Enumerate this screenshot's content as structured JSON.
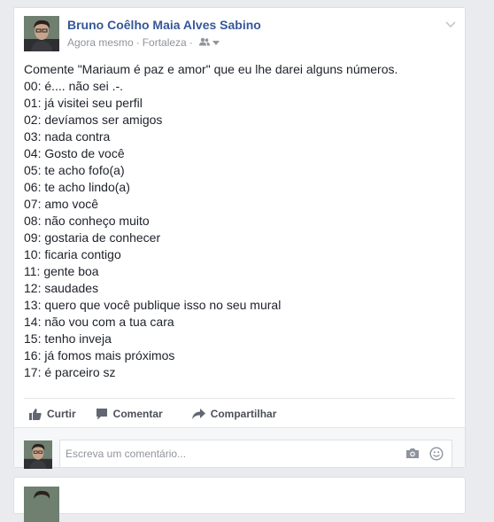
{
  "post": {
    "author": "Bruno Coêlho Maia Alves Sabino",
    "time": "Agora mesmo",
    "separator": "·",
    "location": "Fortaleza",
    "lines": [
      "Comente \"Mariaum é paz e amor\" que eu lhe darei alguns números.",
      "00: é.... não sei .-.",
      "01: já visitei seu perfil",
      "02: devíamos ser amigos",
      "03: nada contra",
      "04: Gosto de você",
      "05: te acho fofo(a)",
      "06: te acho lindo(a)",
      "07: amo você",
      "08: não conheço muito",
      "09: gostaria de conhecer",
      "10: ficaria contigo",
      "11: gente boa",
      "12: saudades",
      "13: quero que você publique isso no seu mural",
      "14: não vou com a tua cara",
      "15: tenho inveja",
      "16: já fomos mais próximos",
      "17: é parceiro sz"
    ]
  },
  "actions": {
    "like": "Curtir",
    "comment": "Comentar",
    "share": "Compartilhar"
  },
  "comment_box": {
    "placeholder": "Escreva um comentário..."
  },
  "icons": {
    "audience": "friends-icon",
    "menu": "chevron-down-icon",
    "like": "thumbs-up-icon",
    "comment": "speech-bubble-icon",
    "share": "share-arrow-icon",
    "camera": "camera-icon",
    "emoji": "smiley-icon"
  },
  "colors": {
    "link": "#365899",
    "meta": "#90949c",
    "text": "#1d2129",
    "page_bg": "#e9ebee"
  }
}
